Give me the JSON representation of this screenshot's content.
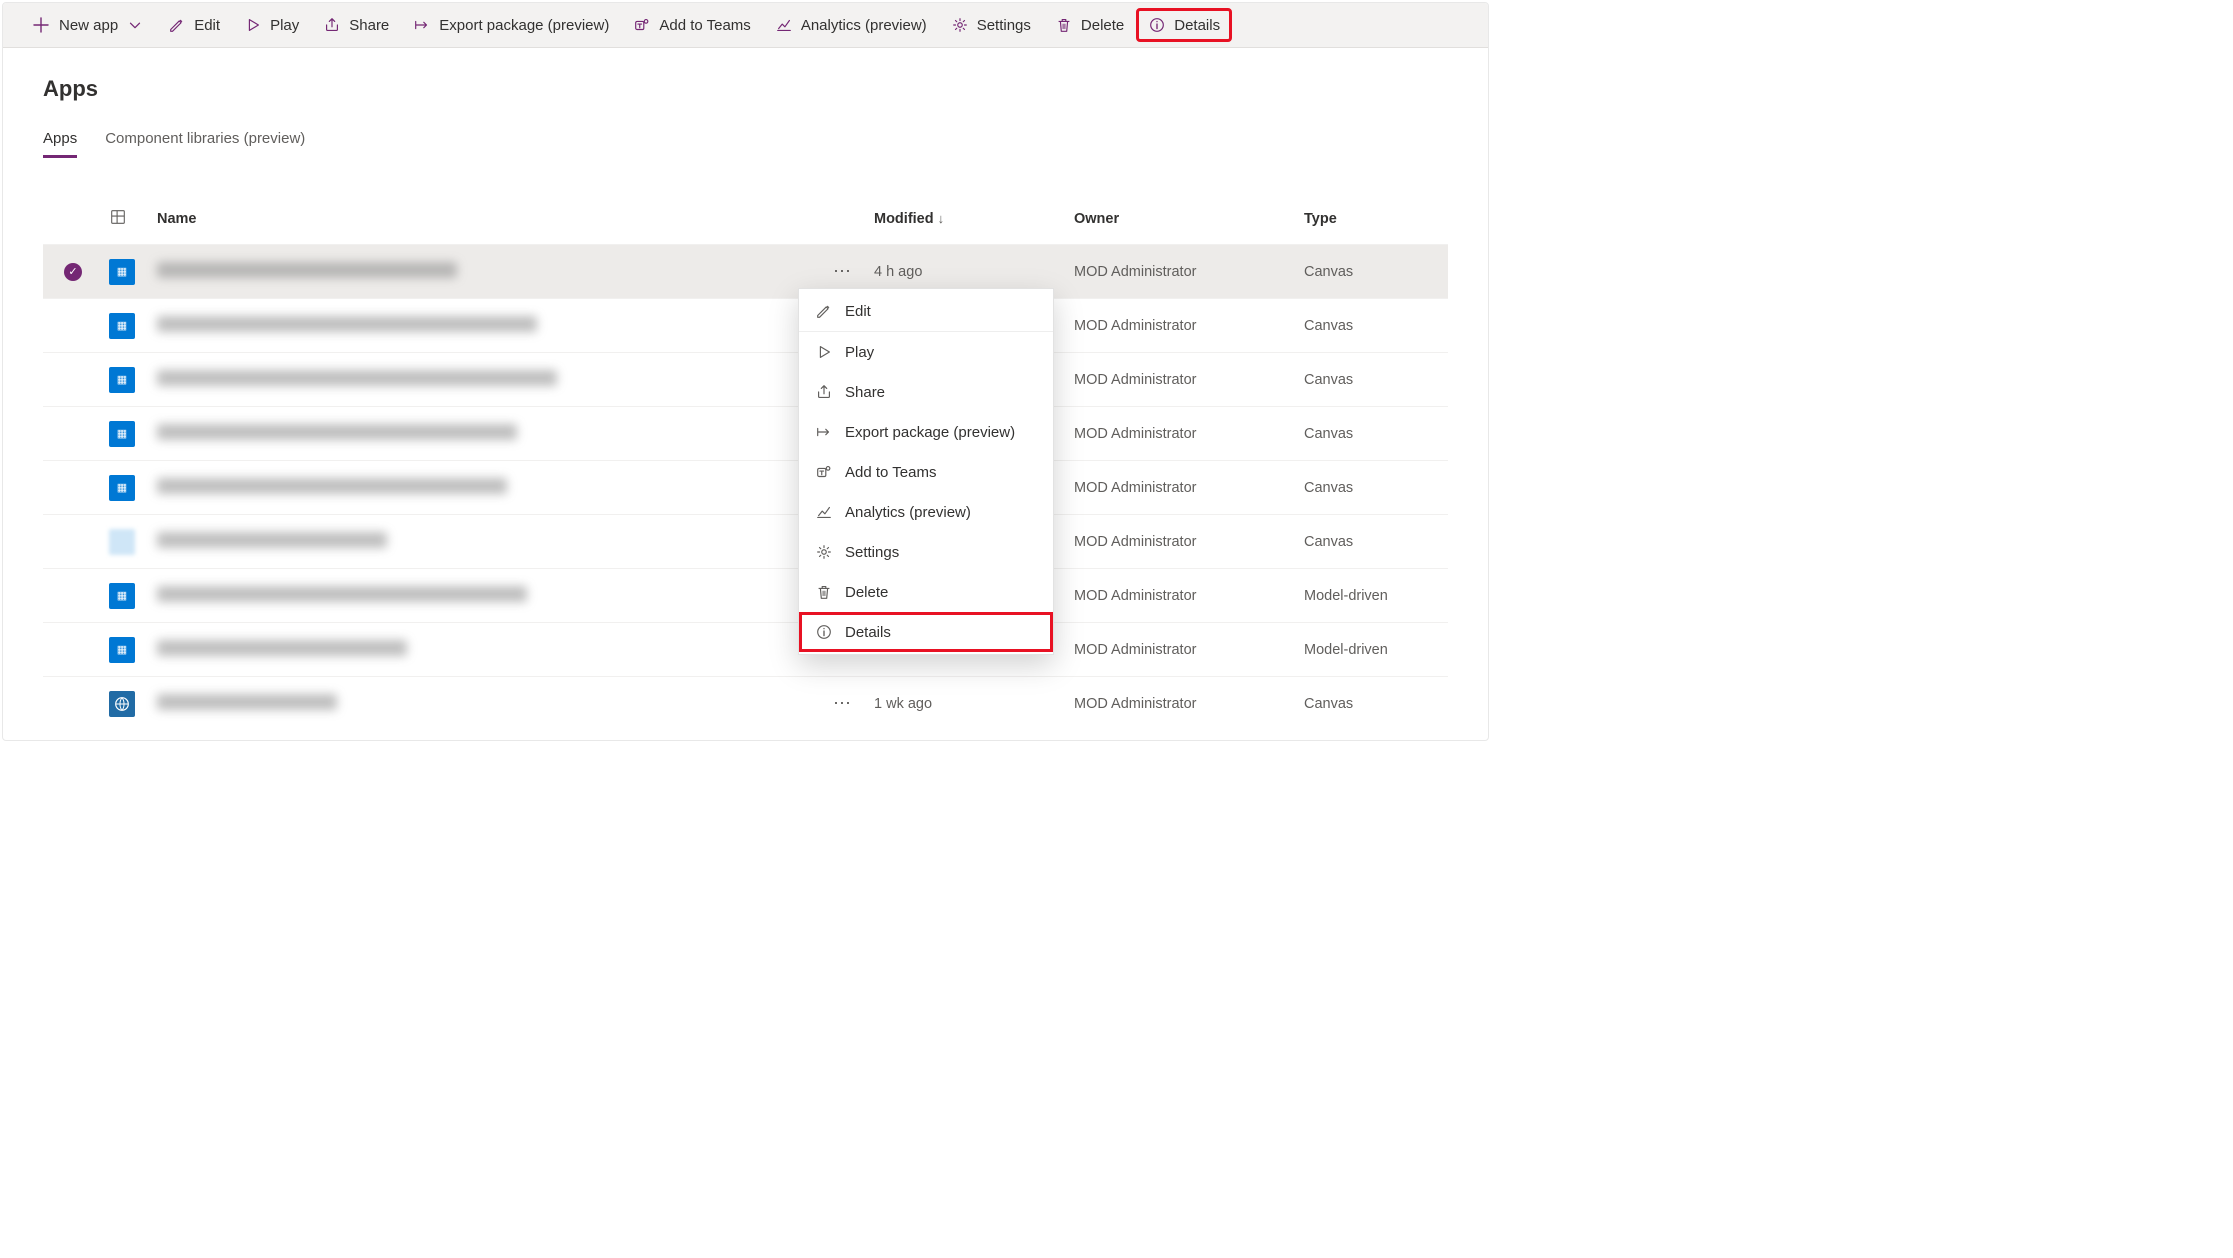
{
  "commandBar": {
    "newApp": "New app",
    "edit": "Edit",
    "play": "Play",
    "share": "Share",
    "exportPackage": "Export package (preview)",
    "addToTeams": "Add to Teams",
    "analytics": "Analytics (preview)",
    "settings": "Settings",
    "delete": "Delete",
    "details": "Details"
  },
  "page": {
    "title": "Apps"
  },
  "tabs": {
    "apps": "Apps",
    "componentLibraries": "Component libraries (preview)"
  },
  "columns": {
    "name": "Name",
    "modified": "Modified",
    "owner": "Owner",
    "type": "Type"
  },
  "contextMenu": {
    "edit": "Edit",
    "play": "Play",
    "share": "Share",
    "exportPackage": "Export package (preview)",
    "addToTeams": "Add to Teams",
    "analytics": "Analytics (preview)",
    "settings": "Settings",
    "delete": "Delete",
    "details": "Details"
  },
  "rows": [
    {
      "selected": true,
      "iconVariant": "a",
      "nameWidth": 300,
      "modified": "4 h ago",
      "owner": "MOD Administrator",
      "type": "Canvas"
    },
    {
      "selected": false,
      "iconVariant": "a",
      "nameWidth": 380,
      "modified": "",
      "owner": "MOD Administrator",
      "type": "Canvas"
    },
    {
      "selected": false,
      "iconVariant": "a",
      "nameWidth": 400,
      "modified": "",
      "owner": "MOD Administrator",
      "type": "Canvas"
    },
    {
      "selected": false,
      "iconVariant": "a",
      "nameWidth": 360,
      "modified": "",
      "owner": "MOD Administrator",
      "type": "Canvas"
    },
    {
      "selected": false,
      "iconVariant": "a",
      "nameWidth": 350,
      "modified": "",
      "owner": "MOD Administrator",
      "type": "Canvas"
    },
    {
      "selected": false,
      "iconVariant": "b",
      "nameWidth": 230,
      "modified": "",
      "owner": "MOD Administrator",
      "type": "Canvas"
    },
    {
      "selected": false,
      "iconVariant": "a",
      "nameWidth": 370,
      "modified": "",
      "owner": "MOD Administrator",
      "type": "Model-driven"
    },
    {
      "selected": false,
      "iconVariant": "a",
      "nameWidth": 250,
      "modified": "",
      "owner": "MOD Administrator",
      "type": "Model-driven"
    },
    {
      "selected": false,
      "iconVariant": "c",
      "nameWidth": 180,
      "modified": "1 wk ago",
      "owner": "MOD Administrator",
      "type": "Canvas"
    }
  ],
  "menuAnchorRow": 0
}
